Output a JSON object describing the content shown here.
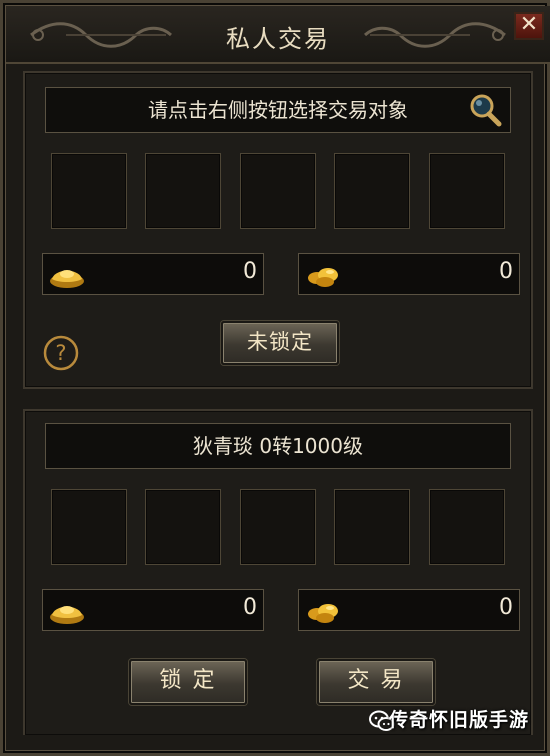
{
  "window": {
    "title": "私人交易",
    "close_glyph": "✕"
  },
  "partner_panel": {
    "prompt": "请点击右侧按钮选择交易对象",
    "search_icon": "magnifier-icon",
    "slots": [
      "",
      "",
      "",
      "",
      ""
    ],
    "gold_value": "0",
    "ingot_value": "0",
    "lock_status_label": "未锁定",
    "help_icon": "question-mark-icon"
  },
  "my_panel": {
    "player_info": "狄青琰  0转1000级",
    "slots": [
      "",
      "",
      "",
      "",
      ""
    ],
    "gold_value": "0",
    "ingot_value": "0",
    "lock_label": "锁 定",
    "trade_label": "交 易"
  },
  "watermark": {
    "text": "传奇怀旧版手游",
    "icon": "wechat-icon"
  },
  "colors": {
    "gold": "#e0a62a",
    "text": "#ece4d2",
    "close_red": "#7a2a1e"
  }
}
